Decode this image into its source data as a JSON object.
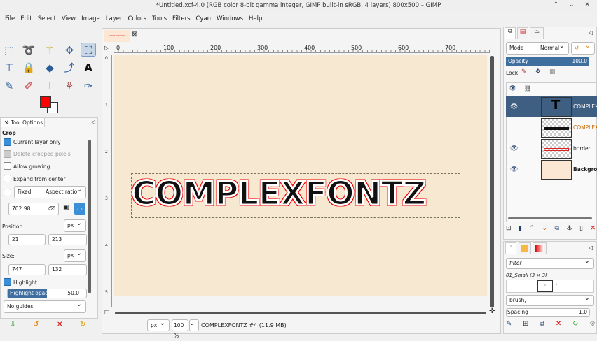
{
  "window": {
    "title": "*Untitled.xcf-4.0 (RGB color 8-bit gamma integer, GIMP built-in sRGB, 4 layers) 800x500 – GIMP",
    "controls": "⌃ ⌄ ✕"
  },
  "menu": [
    "File",
    "Edit",
    "Select",
    "View",
    "Image",
    "Layer",
    "Colors",
    "Tools",
    "Filters",
    "Cyan",
    "Windows",
    "Help"
  ],
  "colors": {
    "foreground": "#ff0000",
    "background": "#ffffff",
    "accent": "#3a8fd6",
    "canvas": "#f7e8d2"
  },
  "tool_options": {
    "tab": "Tool Options",
    "tool": "Crop",
    "current_layer_only": "Current layer only",
    "delete_cropped": "Delete cropped pixels",
    "allow_growing": "Allow growing",
    "expand_from_center": "Expand from center",
    "fixed": "Fixed",
    "fixed_mode": "Aspect ratio",
    "ratio": "702:98",
    "position_label": "Position:",
    "position_unit": "px",
    "pos_x": "21",
    "pos_y": "213",
    "size_label": "Size:",
    "size_unit": "px",
    "size_w": "747",
    "size_h": "132",
    "highlight": "Highlight",
    "highlight_opacity_label": "Highlight opacity",
    "highlight_opacity": "50.0",
    "guides": "No guides"
  },
  "image_tab": {
    "thumb_text": "COMPLEXFONTZ"
  },
  "ruler": [
    "0",
    "100",
    "200",
    "300",
    "400",
    "500",
    "600",
    "700"
  ],
  "vruler": [
    "0",
    "1",
    "2",
    "3",
    "4",
    "5"
  ],
  "canvas": {
    "text": "COMPLEXFONTZ"
  },
  "status": {
    "unit": "px",
    "zoom": "100 %",
    "info": "COMPLEXFONTZ #4 (11.9 MB)"
  },
  "layers": {
    "mode_label": "Mode",
    "mode": "Normal",
    "opacity_label": "Opacity",
    "opacity": "100.0",
    "lock_label": "Lock:",
    "items": [
      {
        "name": "COMPLEXFONTZ",
        "visible": true,
        "selected": true
      },
      {
        "name": "COMPLEXFONTZ",
        "visible": false,
        "selected": false
      },
      {
        "name": "border",
        "visible": true,
        "selected": false
      },
      {
        "name": "Background",
        "visible": true,
        "selected": false
      }
    ]
  },
  "brushes": {
    "filter": "filter",
    "brush_name": "01_Small (3 × 3)",
    "tag": "brush,",
    "spacing_label": "Spacing",
    "spacing": "1.0"
  }
}
